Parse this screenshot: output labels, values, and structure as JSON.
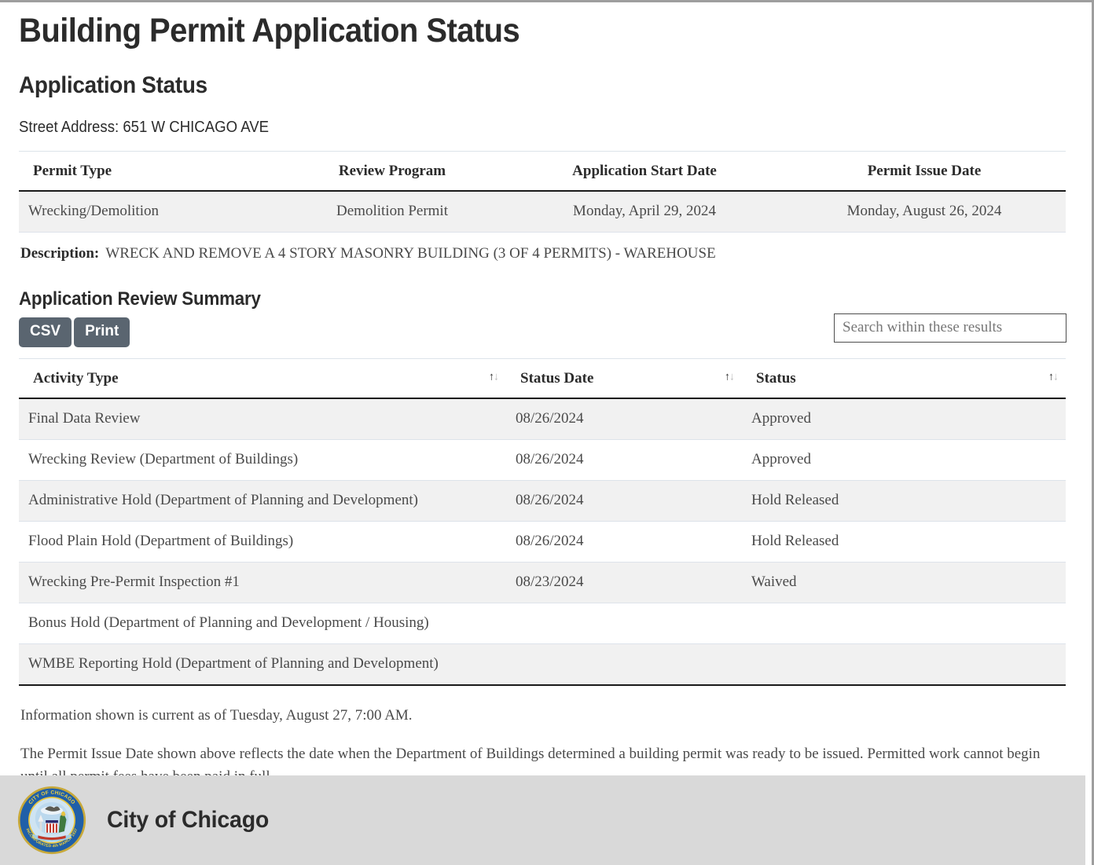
{
  "page": {
    "title": "Building Permit Application Status",
    "section_title": "Application Status",
    "street_address": "Street Address: 651 W CHICAGO AVE"
  },
  "permit_table": {
    "headers": [
      "Permit Type",
      "Review Program",
      "Application Start Date",
      "Permit Issue Date"
    ],
    "row": {
      "permit_type": "Wrecking/Demolition",
      "review_program": "Demolition Permit",
      "application_start_date": "Monday, April 29, 2024",
      "permit_issue_date": "Monday, August 26, 2024"
    }
  },
  "description": {
    "label": "Description:",
    "text": "WRECK AND REMOVE A 4 STORY MASONRY BUILDING (3 OF 4 PERMITS) - WAREHOUSE"
  },
  "review_summary": {
    "title": "Application Review Summary",
    "toolbar": {
      "csv_label": "CSV",
      "print_label": "Print",
      "search_placeholder": "Search within these results",
      "search_value": ""
    },
    "headers": [
      "Activity Type",
      "Status Date",
      "Status"
    ],
    "sort_icon": {
      "up": "↑",
      "down": "↓"
    },
    "rows": [
      {
        "activity_type": "Final Data Review",
        "status_date": "08/26/2024",
        "status": "Approved"
      },
      {
        "activity_type": "Wrecking Review (Department of Buildings)",
        "status_date": "08/26/2024",
        "status": "Approved"
      },
      {
        "activity_type": "Administrative Hold (Department of Planning and Development)",
        "status_date": "08/26/2024",
        "status": "Hold Released"
      },
      {
        "activity_type": "Flood Plain Hold (Department of Buildings)",
        "status_date": "08/26/2024",
        "status": "Hold Released"
      },
      {
        "activity_type": "Wrecking Pre-Permit Inspection #1",
        "status_date": "08/23/2024",
        "status": "Waived"
      },
      {
        "activity_type": "Bonus Hold (Department of Planning and Development / Housing)",
        "status_date": "",
        "status": ""
      },
      {
        "activity_type": "WMBE Reporting Hold (Department of Planning and Development)",
        "status_date": "",
        "status": ""
      }
    ]
  },
  "footnotes": {
    "currency_notice": "Information shown is current as of Tuesday, August 27, 7:00 AM.",
    "issue_date_notice": "The Permit Issue Date shown above reflects the date when the Department of Buildings determined a building permit was ready to be issued. Permitted work cannot begin until all permit fees have been paid in full."
  },
  "footer": {
    "org_name": "City of Chicago",
    "seal": {
      "outer_text": "CITY OF CHICAGO",
      "inner_text": "INCORPORATED 4th MARCH 1837",
      "ring_color": "#1f5fa8",
      "rim_color": "#c8a93a",
      "text_color": "#f2d23c"
    }
  }
}
